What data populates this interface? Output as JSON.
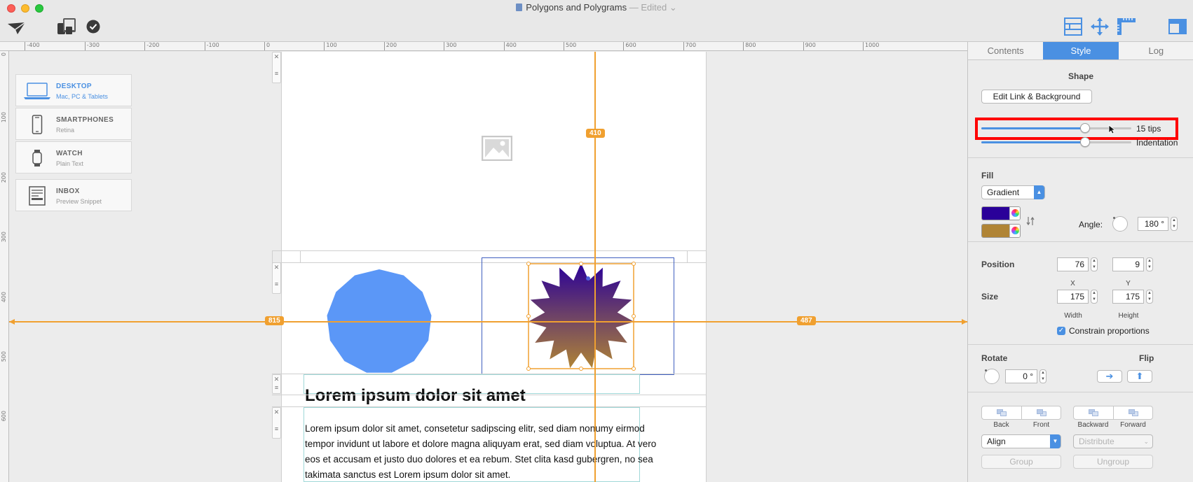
{
  "window": {
    "title": "Polygons and Polygrams",
    "edited": "— Edited"
  },
  "toolbar": {
    "left_icons": [
      "send-icon",
      "devices-icon",
      "checkmark-icon"
    ],
    "right_icons": [
      "layout-icon",
      "move-icon",
      "ruler-icon",
      "sidebar-icon"
    ]
  },
  "ruler": {
    "top_ticks": [
      "-400",
      "-300",
      "-200",
      "-100",
      "0",
      "100",
      "200",
      "300",
      "400",
      "500",
      "600",
      "700",
      "800",
      "900",
      "1000"
    ],
    "left_ticks": [
      "0",
      "100",
      "200",
      "300",
      "400",
      "500",
      "600"
    ]
  },
  "devices": [
    {
      "name": "DESKTOP",
      "sub": "Mac, PC & Tablets",
      "icon": "laptop-icon",
      "active": true
    },
    {
      "name": "SMARTPHONES",
      "sub": "Retina",
      "icon": "phone-icon",
      "active": false
    },
    {
      "name": "WATCH",
      "sub": "Plain Text",
      "icon": "watch-icon",
      "active": false
    },
    {
      "name": "INBOX",
      "sub": "Preview Snippet",
      "icon": "inbox-icon",
      "active": false
    }
  ],
  "canvas": {
    "guides": {
      "left": "815",
      "right": "487",
      "top": "410"
    },
    "heading": "Lorem ipsum dolor sit amet",
    "paragraph": "Lorem ipsum dolor sit amet, consetetur sadipscing elitr, sed diam nonumy eirmod tempor invidunt ut labore et dolore magna aliquyam erat, sed diam voluptua. At vero eos et accusam et justo duo dolores et ea rebum. Stet clita kasd gubergren, no sea takimata sanctus est Lorem ipsum dolor sit amet.",
    "polygon_color": "#5b97f7",
    "star_gradient": [
      "#2a0099",
      "#b08435"
    ]
  },
  "inspector": {
    "tabs": [
      {
        "label": "Contents",
        "active": false
      },
      {
        "label": "Style",
        "active": true
      },
      {
        "label": "Log",
        "active": false
      }
    ],
    "shape": {
      "title": "Shape",
      "edit_button": "Edit Link & Background",
      "tips_label": "15 tips",
      "tips_value": 0.69,
      "indentation_label": "Indentation",
      "indentation_value": 0.69
    },
    "fill": {
      "title": "Fill",
      "type": "Gradient",
      "color1": "#2a0099",
      "color2": "#b08435",
      "angle_label": "Angle:",
      "angle_value": "180 °"
    },
    "position": {
      "label": "Position",
      "x": "76",
      "y": "9",
      "x_label": "X",
      "y_label": "Y"
    },
    "size": {
      "label": "Size",
      "width": "175",
      "height": "175",
      "width_label": "Width",
      "height_label": "Height",
      "constrain_label": "Constrain proportions",
      "constrain_checked": true
    },
    "rotate": {
      "label": "Rotate",
      "value": "0 °"
    },
    "flip": {
      "label": "Flip"
    },
    "arrange": {
      "back": "Back",
      "front": "Front",
      "backward": "Backward",
      "forward": "Forward"
    },
    "align": {
      "align_label": "Align",
      "distribute_label": "Distribute",
      "group_label": "Group",
      "ungroup_label": "Ungroup"
    }
  }
}
